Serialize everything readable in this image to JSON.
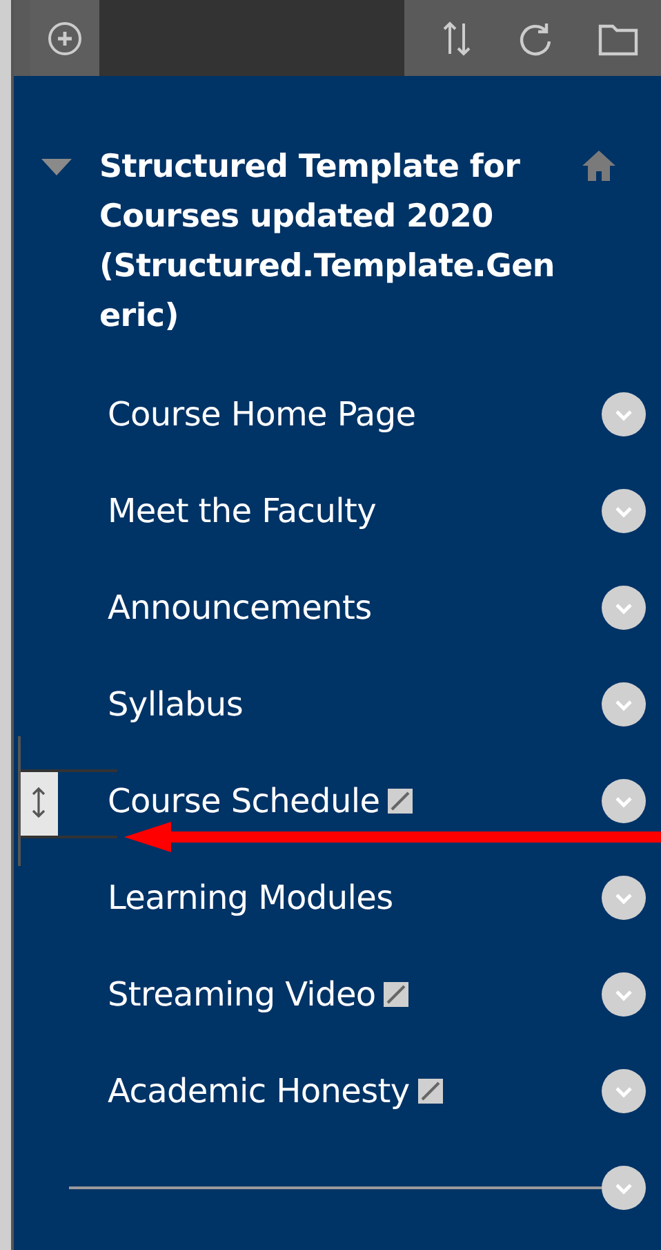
{
  "course": {
    "title": "Structured Template for Courses updated 2020 (Structured.Template.Generic)",
    "expanded": true
  },
  "items": [
    {
      "kind": "link",
      "label": "Course Home Page",
      "hidden": false,
      "dragging": false
    },
    {
      "kind": "link",
      "label": "Meet the Faculty",
      "hidden": false,
      "dragging": false
    },
    {
      "kind": "link",
      "label": "Announcements",
      "hidden": false,
      "dragging": false
    },
    {
      "kind": "link",
      "label": "Syllabus",
      "hidden": false,
      "dragging": false
    },
    {
      "kind": "link",
      "label": "Course Schedule",
      "hidden": true,
      "dragging": true
    },
    {
      "kind": "link",
      "label": "Learning Modules",
      "hidden": false,
      "dragging": false
    },
    {
      "kind": "link",
      "label": "Streaming Video",
      "hidden": true,
      "dragging": false
    },
    {
      "kind": "link",
      "label": "Academic Honesty",
      "hidden": true,
      "dragging": false
    },
    {
      "kind": "divider"
    }
  ],
  "annotation": {
    "kind": "arrow"
  }
}
